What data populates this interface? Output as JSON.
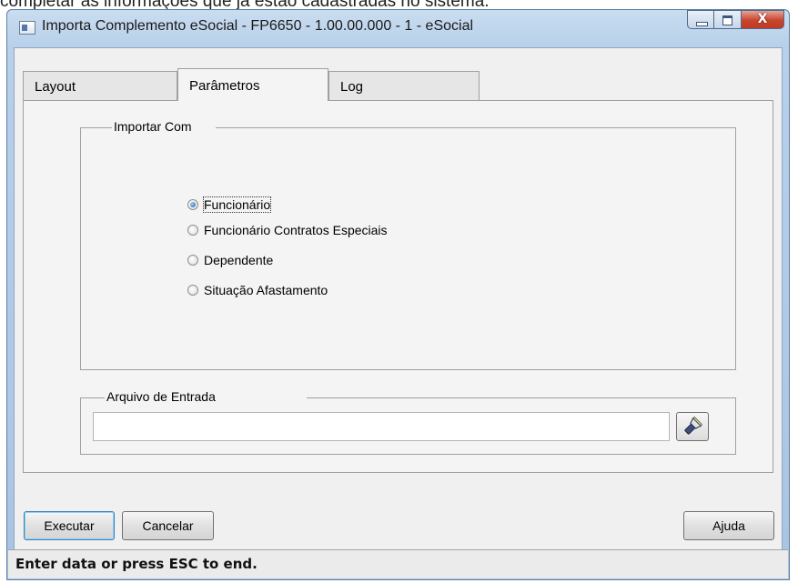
{
  "doc_text": "completar as informações que já estão cadastradas no sistema.",
  "window": {
    "title": "Importa Complemento eSocial - FP6650 - 1.00.00.000 - 1 - eSocial",
    "close_glyph": "X"
  },
  "tabs": [
    {
      "label": "Layout"
    },
    {
      "label": "Parâmetros",
      "active": true
    },
    {
      "label": "Log"
    }
  ],
  "import_group": {
    "title": "Importar Com",
    "options": [
      {
        "label": "Funcionário",
        "checked": true
      },
      {
        "label": "Funcionário Contratos Especiais",
        "checked": false
      },
      {
        "label": "Dependente",
        "checked": false
      },
      {
        "label": "Situação Afastamento",
        "checked": false
      }
    ]
  },
  "file_group": {
    "title": "Arquivo de Entrada",
    "value": "",
    "browse_icon": "flashlight-search-icon"
  },
  "buttons": {
    "execute": "Executar",
    "cancel": "Cancelar",
    "help": "Ajuda"
  },
  "status": "Enter data or press ESC to end.",
  "colors": {
    "titlebar": "#b8d0ea",
    "close_button": "#c8452e",
    "panel": "#f0f0f0",
    "radio_selected": "#1f5fa8"
  }
}
